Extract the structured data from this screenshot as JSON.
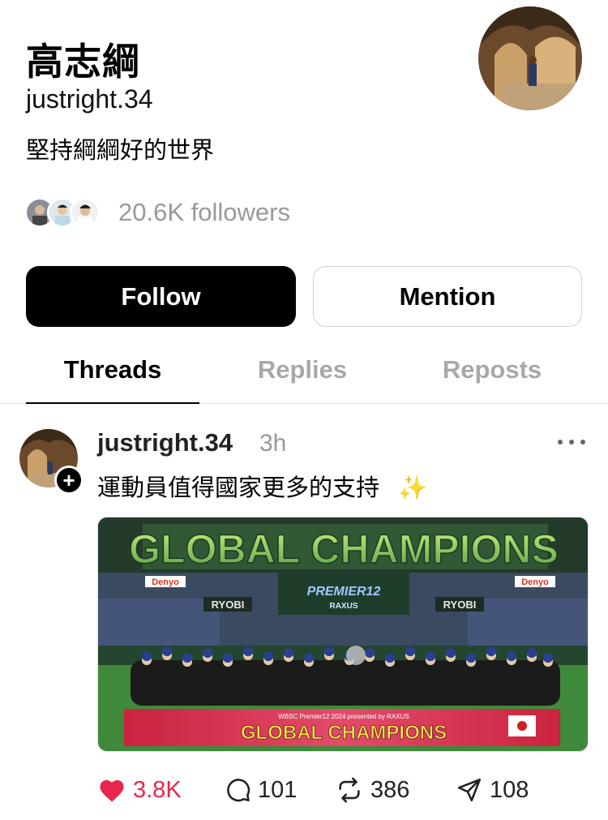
{
  "profile": {
    "name": "高志綱",
    "handle": "justright.34",
    "bio": "堅持綱綱好的世界",
    "followers": "20.6K followers"
  },
  "buttons": {
    "follow": "Follow",
    "mention": "Mention"
  },
  "tabs": [
    {
      "label": "Threads",
      "active": true
    },
    {
      "label": "Replies",
      "active": false
    },
    {
      "label": "Reposts",
      "active": false
    }
  ],
  "post": {
    "user": "justright.34",
    "time": "3h",
    "text": "運動員值得國家更多的支持",
    "emoji": "✨",
    "image": {
      "banner": "GLOBAL CHAMPIONS",
      "sponsors": [
        "Denyo",
        "RYOBI",
        "RYOBI",
        "Denyo"
      ],
      "logo": "PREMIER12",
      "logo_sub": "RAXUS",
      "board_caption": "WBSC Premier12 2024 presented by RAXUS",
      "board_title": "GLOBAL CHAMPIONS"
    },
    "stats": {
      "likes": "3.8K",
      "replies": "101",
      "reposts": "386",
      "shares": "108"
    }
  },
  "colors": {
    "like": "#e8264d",
    "follow_bg": "#000000",
    "muted": "#999999"
  }
}
